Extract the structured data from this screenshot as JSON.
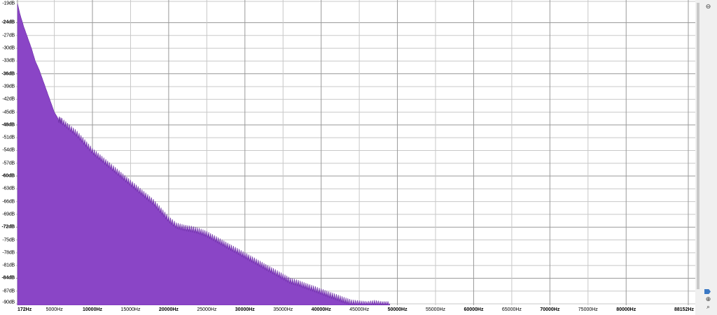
{
  "chart_data": {
    "type": "area",
    "y_tick_labels": [
      "-19dB",
      "-24dB",
      "-27dB",
      "-30dB",
      "-33dB",
      "-36dB",
      "-39dB",
      "-42dB",
      "-45dB",
      "-48dB",
      "-51dB",
      "-54dB",
      "-57dB",
      "-60dB",
      "-63dB",
      "-66dB",
      "-69dB",
      "-72dB",
      "-75dB",
      "-78dB",
      "-81dB",
      "-84dB",
      "-87dB",
      "-90dB"
    ],
    "y_ticks": [
      -19,
      -24,
      -27,
      -30,
      -33,
      -36,
      -39,
      -42,
      -45,
      -48,
      -51,
      -54,
      -57,
      -60,
      -63,
      -66,
      -69,
      -72,
      -75,
      -78,
      -81,
      -84,
      -87,
      -90
    ],
    "y_major": [
      -24,
      -36,
      -48,
      -60,
      -72,
      -84
    ],
    "ylim": [
      -90,
      -19
    ],
    "x_tick_labels": [
      "172Hz",
      "5000Hz",
      "10000Hz",
      "15000Hz",
      "20000Hz",
      "25000Hz",
      "30000Hz",
      "35000Hz",
      "40000Hz",
      "45000Hz",
      "50000Hz",
      "55000Hz",
      "60000Hz",
      "65000Hz",
      "70000Hz",
      "75000Hz",
      "80000Hz",
      "88152Hz"
    ],
    "x_ticks": [
      172,
      5000,
      10000,
      15000,
      20000,
      25000,
      30000,
      35000,
      40000,
      45000,
      50000,
      55000,
      60000,
      65000,
      70000,
      75000,
      80000,
      88152
    ],
    "x_major": [
      172,
      10000,
      20000,
      30000,
      40000,
      50000,
      60000,
      70000,
      80000,
      88152
    ],
    "xlim": [
      172,
      88152
    ],
    "grid": true,
    "fill_color": "#8a45c6",
    "series": [
      {
        "x": [
          172,
          500,
          1000,
          1500,
          2000,
          2500,
          3000,
          3500,
          4000,
          4500,
          5000,
          5500,
          6000,
          7000,
          8000,
          9000,
          10000,
          11000,
          12000,
          13000,
          14000,
          15000,
          16000,
          17000,
          18000,
          19000,
          20000,
          21000,
          22000,
          23000,
          24000,
          25000,
          26000,
          27000,
          28000,
          29000,
          30000,
          31000,
          32000,
          33000,
          34000,
          35000,
          36000,
          37000,
          38000,
          39000,
          40000,
          41000,
          42000,
          43000,
          44000,
          45000,
          46000,
          47000,
          48000,
          49000
        ],
        "values": [
          -19.5,
          -22,
          -25,
          -27.5,
          -30,
          -33,
          -35,
          -37.5,
          -40,
          -42.5,
          -45,
          -46.5,
          -47,
          -48.5,
          -50,
          -52,
          -54,
          -55.5,
          -57,
          -58.5,
          -60,
          -61.5,
          -63,
          -64.5,
          -66,
          -68,
          -70,
          -71.5,
          -72,
          -72.3,
          -72.8,
          -73.5,
          -74.5,
          -75.5,
          -76.5,
          -77.5,
          -78.5,
          -79.5,
          -80.5,
          -81.5,
          -82.5,
          -83.5,
          -84.5,
          -85,
          -85.7,
          -86.3,
          -87,
          -87.7,
          -88.3,
          -89,
          -89.6,
          -89.8,
          -90,
          -89.7,
          -90,
          -90
        ]
      }
    ]
  },
  "icons": {
    "zoom_in": "zoom-in-icon",
    "zoom_out": "zoom-out-icon",
    "scroll_arrow": "scroll-arrow-icon"
  }
}
